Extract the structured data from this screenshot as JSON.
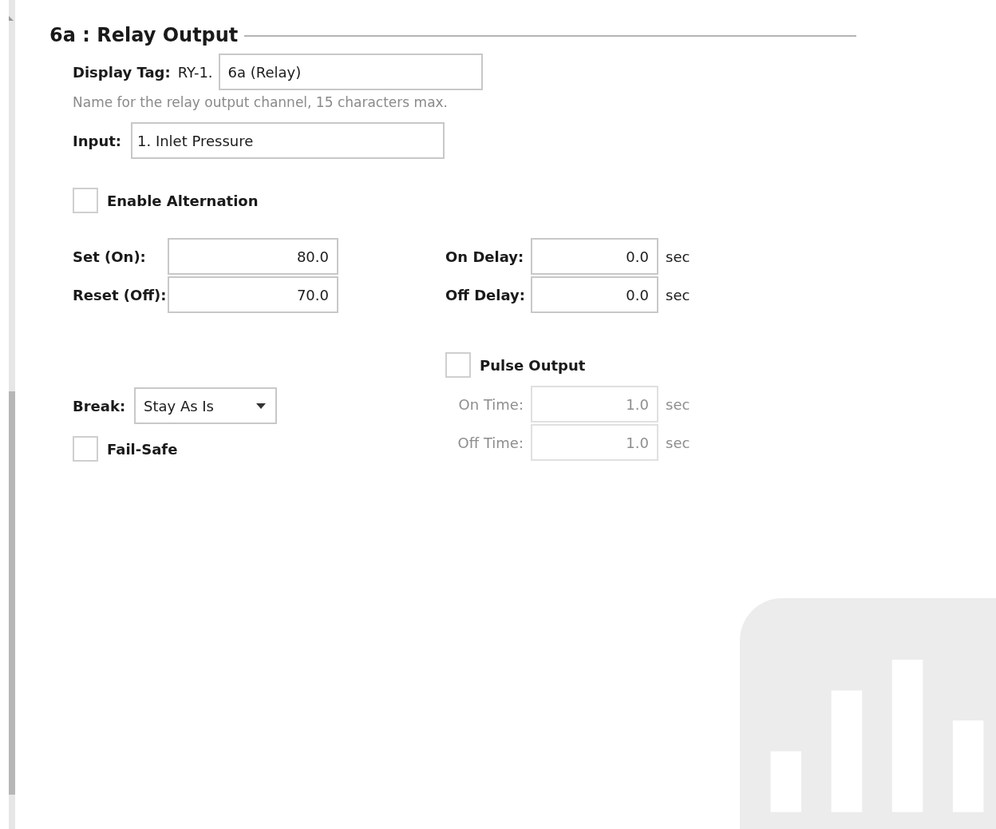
{
  "section": {
    "title": "6a : Relay Output"
  },
  "display_tag": {
    "label": "Display Tag:",
    "prefix": "RY-1.",
    "value": "6a (Relay)",
    "hint": "Name for the relay output channel, 15 characters max."
  },
  "input": {
    "label": "Input:",
    "value": "1. Inlet Pressure"
  },
  "enable_alternation": {
    "label": "Enable Alternation",
    "checked": false
  },
  "setpoints": [
    {
      "label": "Set (On):",
      "value": "80.0"
    },
    {
      "label": "Reset (Off):",
      "value": "70.0"
    }
  ],
  "delays": [
    {
      "label": "On Delay:",
      "value": "0.0",
      "unit": "sec",
      "disabled": false
    },
    {
      "label": "Off Delay:",
      "value": "0.0",
      "unit": "sec",
      "disabled": false
    }
  ],
  "pulse_output": {
    "label": "Pulse Output",
    "checked": false
  },
  "pulse_times": [
    {
      "label": "On Time:",
      "value": "1.0",
      "unit": "sec",
      "disabled": true
    },
    {
      "label": "Off Time:",
      "value": "1.0",
      "unit": "sec",
      "disabled": true
    }
  ],
  "break": {
    "label": "Break:",
    "value": "Stay As Is"
  },
  "fail_safe": {
    "label": "Fail-Safe",
    "checked": false
  }
}
